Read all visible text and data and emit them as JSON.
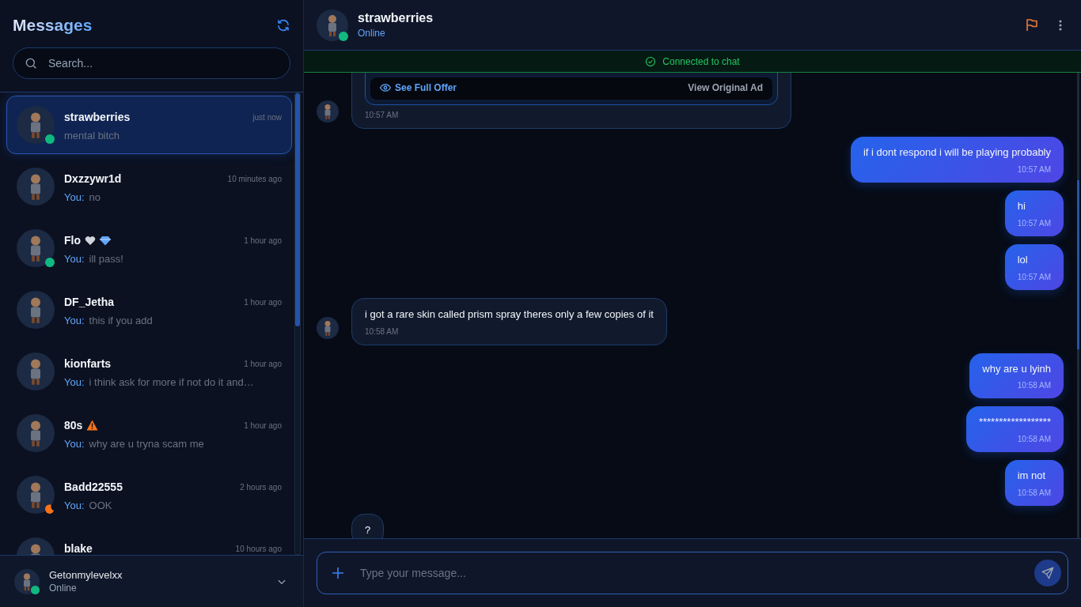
{
  "sidebar": {
    "title": "Messages",
    "search": {
      "placeholder": "Search..."
    },
    "conversations": [
      {
        "name": "strawberries",
        "time": "just now",
        "preview": "mental bitch",
        "selected": true,
        "online": true,
        "idle": false
      },
      {
        "name": "Dxzzywr1d",
        "time": "10 minutes ago",
        "sender": "You:",
        "preview": "no",
        "selected": false,
        "online": false,
        "idle": false
      },
      {
        "name": "Flo",
        "badges": [
          {
            "kind": "heart"
          },
          {
            "kind": "diamond"
          }
        ],
        "time": "1 hour ago",
        "sender": "You:",
        "preview": "ill pass!",
        "selected": false,
        "online": true,
        "idle": false
      },
      {
        "name": "DF_Jetha",
        "time": "1 hour ago",
        "sender": "You:",
        "preview": "this if you add",
        "selected": false,
        "online": false,
        "idle": false
      },
      {
        "name": "kionfarts",
        "time": "1 hour ago",
        "sender": "You:",
        "preview": "i think ask for more if not do it and…",
        "selected": false,
        "online": false,
        "idle": false
      },
      {
        "name": "80s",
        "badges": [
          {
            "kind": "warning"
          }
        ],
        "time": "1 hour ago",
        "sender": "You:",
        "preview": "why are u tryna scam me",
        "selected": false,
        "online": false,
        "idle": false
      },
      {
        "name": "Badd22555",
        "time": "2 hours ago",
        "sender": "You:",
        "preview": "OOK",
        "selected": false,
        "online": false,
        "idle": true
      },
      {
        "name": "blake",
        "time": "10 hours ago",
        "selected": false,
        "online": false,
        "idle": false
      }
    ],
    "current_user": {
      "name": "Getonmylevelxx",
      "status_text": "Online",
      "online": true
    }
  },
  "chat": {
    "header": {
      "name": "strawberries",
      "status_text": "Online",
      "online": true
    },
    "banner": "Connected to chat",
    "messages": [
      {
        "kind": "offer",
        "outgoing": false,
        "links": [
          "See Full Offer",
          "View Original Ad"
        ],
        "time": "10:57 AM"
      },
      {
        "kind": "text",
        "outgoing": true,
        "text": "if i dont respond i will be playing probably",
        "time": "10:57 AM"
      },
      {
        "kind": "text",
        "outgoing": true,
        "text": "hi",
        "time": "10:57 AM"
      },
      {
        "kind": "text",
        "outgoing": true,
        "text": "lol",
        "time": "10:57 AM"
      },
      {
        "kind": "text",
        "outgoing": false,
        "text": "i got a rare skin called prism spray theres only a few copies of it",
        "time": "10:58 AM"
      },
      {
        "kind": "text",
        "outgoing": true,
        "text": "why are u lyinh",
        "time": "10:58 AM"
      },
      {
        "kind": "text",
        "outgoing": true,
        "text": "******************",
        "time": "10:58 AM"
      },
      {
        "kind": "text",
        "outgoing": true,
        "text": "im not",
        "time": "10:58 AM"
      },
      {
        "kind": "text",
        "outgoing": false,
        "text": "?"
      }
    ],
    "composer": {
      "placeholder": "Type your message..."
    }
  }
}
